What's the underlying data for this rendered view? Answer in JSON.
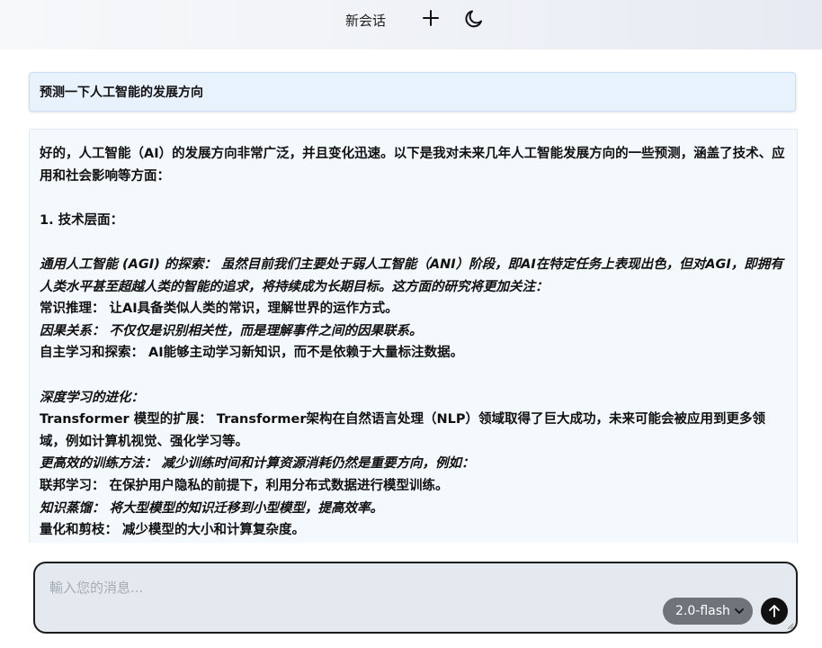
{
  "header": {
    "title": "新会话",
    "new_chat_icon": "plus-icon",
    "theme_icon": "moon-icon"
  },
  "messages": {
    "user": "预测一下人工智能的发展方向",
    "assistant": {
      "intro": "好的，人工智能（AI）的发展方向非常广泛，并且变化迅速。以下是我对未来几年人工智能发展方向的一些预测，涵盖了技术、应用和社会影响等方面：",
      "section1_heading": "1. 技术层面：",
      "agi_title": "通用人工智能 (AGI) 的探索：",
      "agi_text": " 虽然目前我们主要处于弱人工智能（ANI）阶段，即AI在特定任务上表现出色，但对AGI，即拥有人类水平甚至超越人类的智能的追求，将持续成为长期目标。这方面的研究将更加关注：",
      "common_sense_title": "常识推理：",
      "common_sense_text": " 让AI具备类似人类的常识，理解世界的运作方式。",
      "causality_title": "因果关系：",
      "causality_text": " 不仅仅是识别相关性，而是理解事件之间的因果联系。",
      "autonomous_title": "自主学习和探索：",
      "autonomous_text": " AI能够主动学习新知识，而不是依赖于大量标注数据。",
      "deep_learning_title": "深度学习的进化：",
      "transformer_title": "Transformer 模型的扩展：",
      "transformer_text": " Transformer架构在自然语言处理（NLP）领域取得了巨大成功，未来可能会被应用到更多领域，例如计算机视觉、强化学习等。",
      "efficient_title": "更高效的训练方法：",
      "efficient_text": " 减少训练时间和计算资源消耗仍然是重要方向，例如：",
      "federated_title": "联邦学习：",
      "federated_text": " 在保护用户隐私的前提下，利用分布式数据进行模型训练。",
      "distill_title": "知识蒸馏：",
      "distill_text": " 将大型模型的知识迁移到小型模型，提高效率。",
      "quant_title": "量化和剪枝：",
      "quant_text": " 减少模型的大小和计算复杂度。"
    }
  },
  "composer": {
    "placeholder": "輸入您的消息...",
    "model": "2.0-flash",
    "send_icon": "arrow-up-icon"
  }
}
